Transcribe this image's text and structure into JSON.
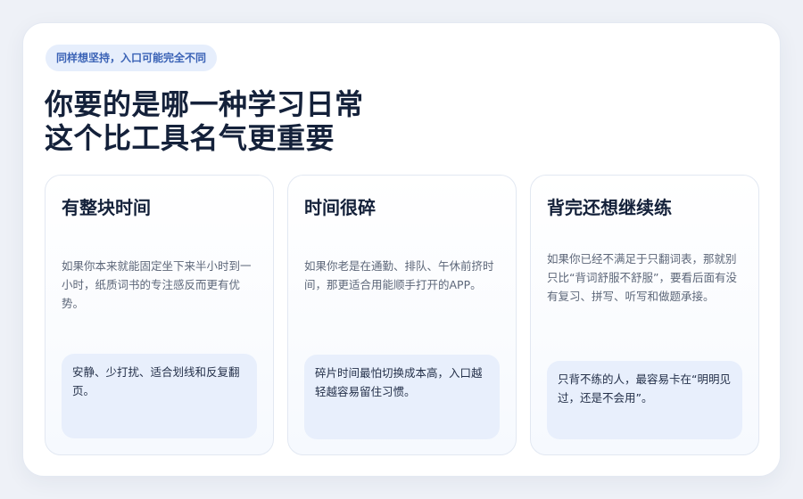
{
  "badge": "同样想坚持，入口可能完全不同",
  "title": {
    "line1": "你要的是哪一种学习日常",
    "line2": "这个比工具名气更重要"
  },
  "cards": [
    {
      "title": "有整块时间",
      "description": "如果你本来就能固定坐下来半小时到一小时，纸质词书的专注感反而更有优势。",
      "note": "安静、少打扰、适合划线和反复翻页。"
    },
    {
      "title": "时间很碎",
      "description": "如果你老是在通勤、排队、午休前挤时间，那更适合用能顺手打开的APP。",
      "note": "碎片时间最怕切换成本高，入口越轻越容易留住习惯。"
    },
    {
      "title": "背完还想继续练",
      "description": "如果你已经不满足于只翻词表，那就别只比“背词舒服不舒服”，要看后面有没有复习、拼写、听写和做题承接。",
      "note": "只背不练的人，最容易卡在“明明见过，还是不会用”。"
    }
  ]
}
